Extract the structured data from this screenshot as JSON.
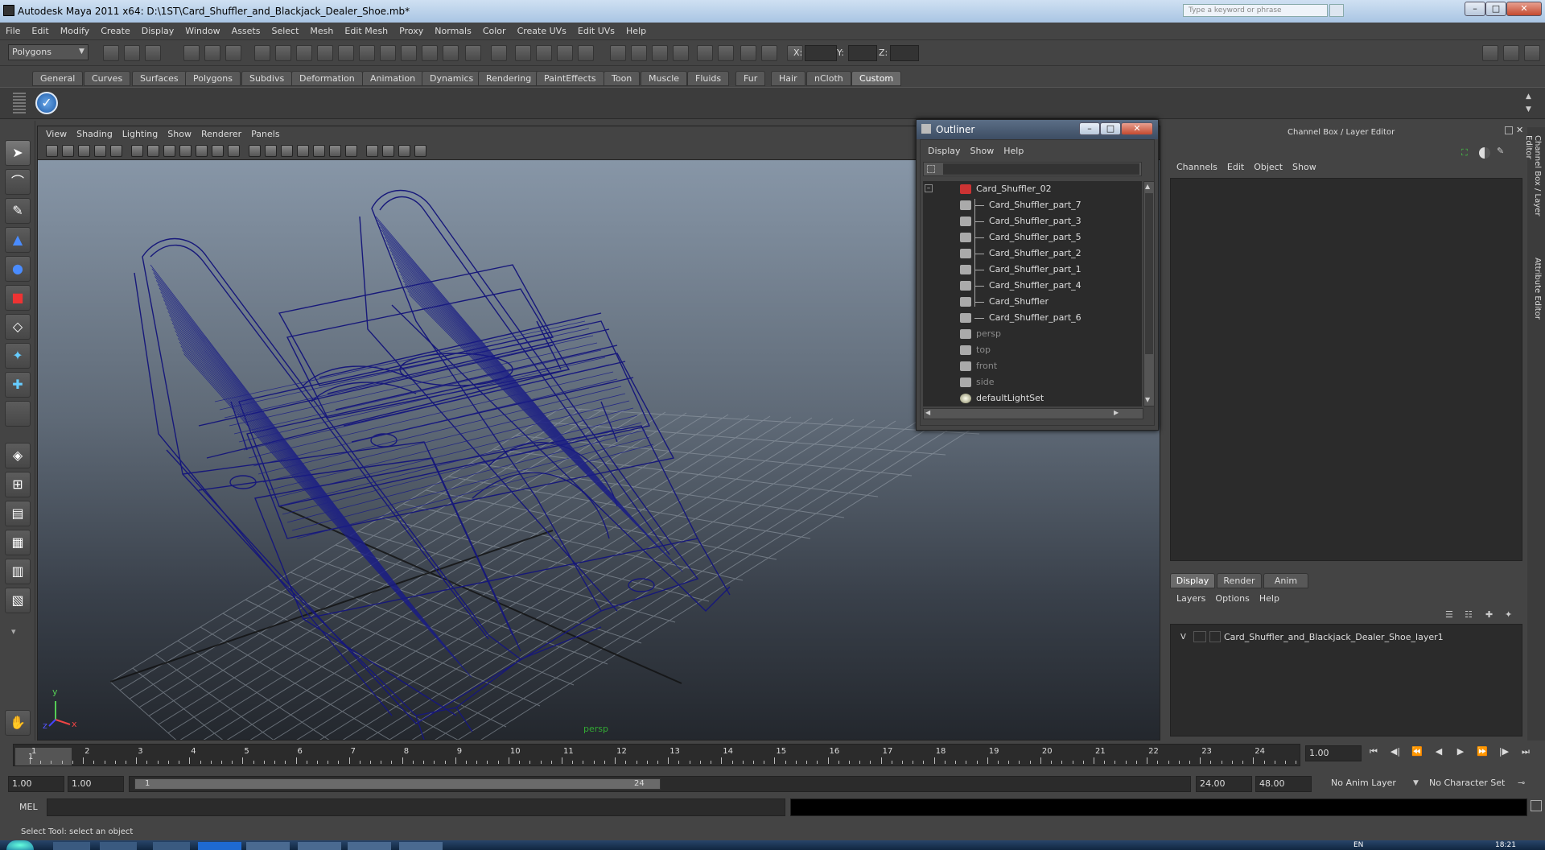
{
  "window": {
    "title": "Autodesk Maya 2011 x64: D:\\1ST\\Card_Shuffler_and_Blackjack_Dealer_Shoe.mb*",
    "search_placeholder": "Type a keyword or phrase"
  },
  "menus": [
    "File",
    "Edit",
    "Modify",
    "Create",
    "Display",
    "Window",
    "Assets",
    "Select",
    "Mesh",
    "Edit Mesh",
    "Proxy",
    "Normals",
    "Color",
    "Create UVs",
    "Edit UVs",
    "Help"
  ],
  "status": {
    "mode": "Polygons",
    "x_label": "X:",
    "y_label": "Y:",
    "z_label": "Z:"
  },
  "shelf_tabs": [
    "General",
    "Curves",
    "Surfaces",
    "Polygons",
    "Subdivs",
    "Deformation",
    "Animation",
    "Dynamics",
    "Rendering",
    "PaintEffects",
    "Toon",
    "Muscle",
    "Fluids",
    "Fur",
    "Hair",
    "nCloth",
    "Custom"
  ],
  "active_shelf": "Custom",
  "viewport": {
    "menus": [
      "View",
      "Shading",
      "Lighting",
      "Show",
      "Renderer",
      "Panels"
    ],
    "camera": "persp",
    "axis_x": "x",
    "axis_y": "y",
    "axis_z": "z"
  },
  "outliner": {
    "title": "Outliner",
    "menus": [
      "Display",
      "Show",
      "Help"
    ],
    "items": [
      {
        "label": "Card_Shuffler_02",
        "dim": false
      },
      {
        "label": "Card_Shuffler_part_7",
        "dim": false
      },
      {
        "label": "Card_Shuffler_part_3",
        "dim": false
      },
      {
        "label": "Card_Shuffler_part_5",
        "dim": false
      },
      {
        "label": "Card_Shuffler_part_2",
        "dim": false
      },
      {
        "label": "Card_Shuffler_part_1",
        "dim": false
      },
      {
        "label": "Card_Shuffler_part_4",
        "dim": false
      },
      {
        "label": "Card_Shuffler",
        "dim": false
      },
      {
        "label": "Card_Shuffler_part_6",
        "dim": false
      },
      {
        "label": "persp",
        "dim": true
      },
      {
        "label": "top",
        "dim": true
      },
      {
        "label": "front",
        "dim": true
      },
      {
        "label": "side",
        "dim": true
      },
      {
        "label": "defaultLightSet",
        "dim": false
      }
    ]
  },
  "channel_box": {
    "title": "Channel Box / Layer Editor",
    "menus": [
      "Channels",
      "Edit",
      "Object",
      "Show"
    ],
    "layer_tabs": [
      "Display",
      "Render",
      "Anim"
    ],
    "layer_menus": [
      "Layers",
      "Options",
      "Help"
    ],
    "layer": {
      "visible": "V",
      "name": "Card_Shuffler_and_Blackjack_Dealer_Shoe_layer1"
    }
  },
  "side_tabs": [
    "Channel Box / Layer Editor",
    "Attribute Editor"
  ],
  "timeline": {
    "ticks": [
      1,
      2,
      3,
      4,
      5,
      6,
      7,
      8,
      9,
      10,
      11,
      12,
      13,
      14,
      15,
      16,
      17,
      18,
      19,
      20,
      21,
      22,
      23,
      24
    ],
    "current": "1",
    "current_field": "1.00"
  },
  "range": {
    "start_a": "1.00",
    "start_b": "1.00",
    "slider_start": "1",
    "slider_end": "24",
    "end_a": "24.00",
    "end_b": "48.00",
    "anim_layer": "No Anim Layer",
    "char_set": "No Character Set"
  },
  "cmd": {
    "label": "MEL"
  },
  "help_line": "Select Tool: select an object",
  "clock": "18:21",
  "lang": "EN"
}
